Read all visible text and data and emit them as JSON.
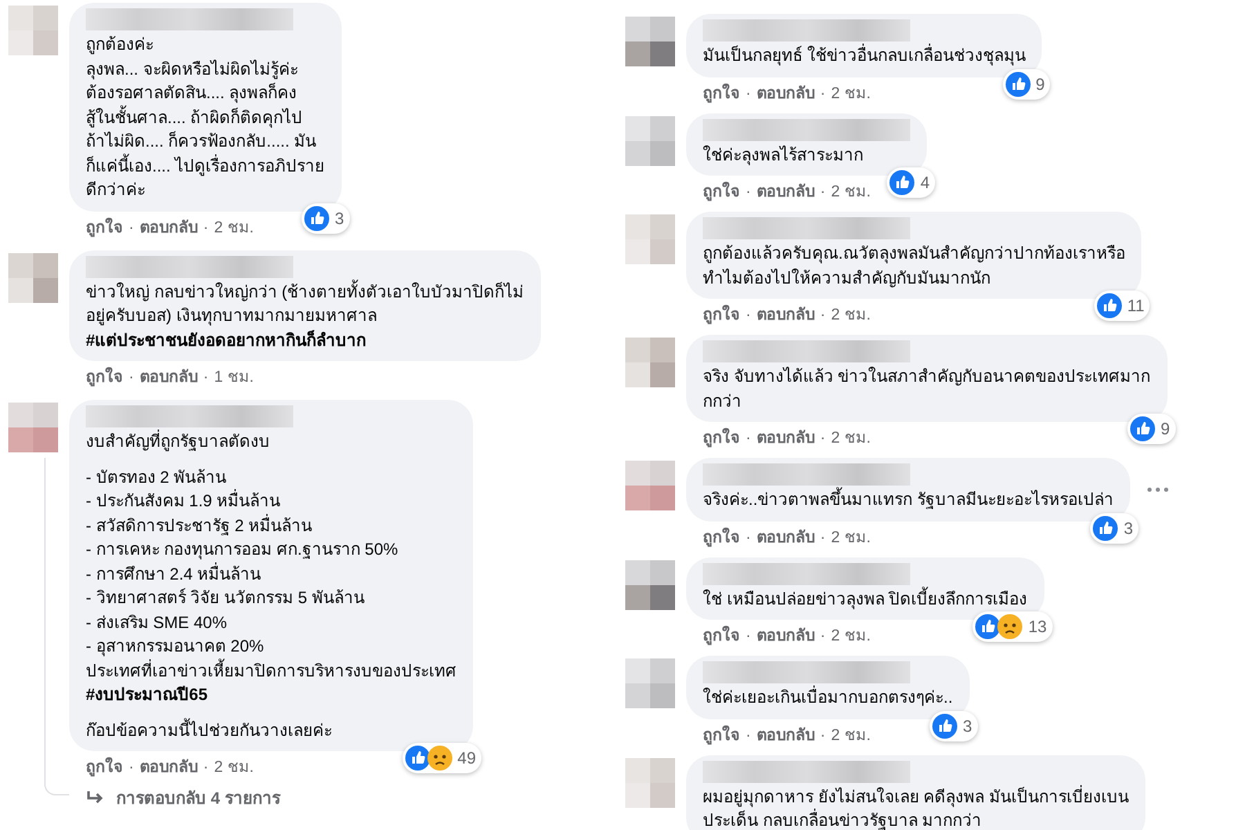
{
  "columns": [
    {
      "comments": [
        {
          "paragraphs": [
            "ถูกต้องค่ะ\nลุงพล... จะผิดหรือไม่ผิดไม่รู้ค่ะ\nต้องรอศาลตัดสิน.... ลุงพลก็คง\nสู้ในชั้นศาล.... ถ้าผิดก็ติดคุกไป\nถ้าไม่ผิด.... ก็ควรฟ้องกลับ..... มัน\nก็แค่นี้เอง.... ไปดูเรื่องการอภิปราย\nดีกว่าค่ะ"
          ],
          "reactions": [
            {
              "kind": "like"
            }
          ],
          "reaction_count": "3",
          "footer": [
            {
              "kind": "link",
              "text": "ถูกใจ"
            },
            {
              "kind": "dot",
              "text": "·"
            },
            {
              "kind": "link",
              "text": "ตอบกลับ"
            },
            {
              "kind": "dot",
              "text": "·"
            },
            {
              "kind": "time",
              "text": "2 ชม."
            }
          ],
          "options_menu": false
        },
        {
          "paragraphs": [
            "ข่าวใหญ่ กลบข่าวใหญ่กว่า (ช้างตายทั้งตัวเอาใบบัวมาปิดก็ไม่\nอยู่ครับบอส) เงินทุกบาทมากมายมหาศาล\n**#แต่ประชาชนยังอดอยากหากินก็ลำบาก**"
          ],
          "footer": [
            {
              "kind": "link",
              "text": "ถูกใจ"
            },
            {
              "kind": "dot",
              "text": "·"
            },
            {
              "kind": "link",
              "text": "ตอบกลับ"
            },
            {
              "kind": "dot",
              "text": "·"
            },
            {
              "kind": "time",
              "text": "1 ชม."
            }
          ],
          "options_menu": false
        },
        {
          "paragraphs": [
            "งบสำคัญที่ถูกรัฐบาลตัดงบ",
            "- บัตรทอง 2 พันล้าน\n- ประกันสังคม 1.9 หมื่นล้าน\n- สวัสดิการประชารัฐ 2 หมื่นล้าน\n- การเคหะ กองทุนการออม ศก.ฐานราก 50%\n- การศึกษา 2.4 หมื่นล้าน\n- วิทยาศาสตร์ วิจัย นวัตกรรม 5 พันล้าน\n- ส่งเสริม SME 40%\n- อุสาหกรรมอนาคต 20%\nประเทศที่เอาข่าวเหี้ยมาปิดการบริหารงบของประเทศ\n**#งบประมาณปี65**",
            "ก๊อปข้อความนี้ไปช่วยกันวางเลยค่ะ"
          ],
          "reactions": [
            {
              "kind": "like"
            },
            {
              "kind": "sad"
            }
          ],
          "reaction_count": "49",
          "footer": [
            {
              "kind": "link",
              "text": "ถูกใจ"
            },
            {
              "kind": "dot",
              "text": "·"
            },
            {
              "kind": "link",
              "text": "ตอบกลับ"
            },
            {
              "kind": "dot",
              "text": "·"
            },
            {
              "kind": "time",
              "text": "2 ชม."
            }
          ],
          "replies_link": "การตอบกลับ 4 รายการ",
          "options_menu": false
        }
      ]
    },
    {
      "comments": [
        {
          "paragraphs": [
            "มันเป็นกลยุทธ์ ใช้ข่าวอื่นกลบเกลื่อนช่วงชุลมุน"
          ],
          "reactions": [
            {
              "kind": "like"
            }
          ],
          "reaction_count": "9",
          "footer": [
            {
              "kind": "link",
              "text": "ถูกใจ"
            },
            {
              "kind": "dot",
              "text": "·"
            },
            {
              "kind": "link",
              "text": "ตอบกลับ"
            },
            {
              "kind": "dot",
              "text": "·"
            },
            {
              "kind": "time",
              "text": "2 ชม."
            }
          ],
          "options_menu": false
        },
        {
          "paragraphs": [
            "ใช่ค่ะลุงพลไร้สาระมาก"
          ],
          "reactions": [
            {
              "kind": "like"
            }
          ],
          "reaction_count": "4",
          "footer": [
            {
              "kind": "link",
              "text": "ถูกใจ"
            },
            {
              "kind": "dot",
              "text": "·"
            },
            {
              "kind": "link",
              "text": "ตอบกลับ"
            },
            {
              "kind": "dot",
              "text": "·"
            },
            {
              "kind": "time",
              "text": "2 ชม."
            }
          ],
          "options_menu": false
        },
        {
          "paragraphs": [
            "ถูกต้องแล้วครับคุณ.ณวัตลุงพลมันสำคัญกว่าปากท้องเราหรือ\nทำไมต้องไปให้ความสำคัญกับมันมากนัก"
          ],
          "reactions": [
            {
              "kind": "like"
            }
          ],
          "reaction_count": "11",
          "footer": [
            {
              "kind": "link",
              "text": "ถูกใจ"
            },
            {
              "kind": "dot",
              "text": "·"
            },
            {
              "kind": "link",
              "text": "ตอบกลับ"
            },
            {
              "kind": "dot",
              "text": "·"
            },
            {
              "kind": "time",
              "text": "2 ชม."
            }
          ],
          "options_menu": false
        },
        {
          "paragraphs": [
            "จริง จับทางได้แล้ว ข่าวในสภาสำคัญกับอนาคตของประเทศมาก\nกกว่า"
          ],
          "reactions": [
            {
              "kind": "like"
            }
          ],
          "reaction_count": "9",
          "footer": [
            {
              "kind": "link",
              "text": "ถูกใจ"
            },
            {
              "kind": "dot",
              "text": "·"
            },
            {
              "kind": "link",
              "text": "ตอบกลับ"
            },
            {
              "kind": "dot",
              "text": "·"
            },
            {
              "kind": "time",
              "text": "2 ชม."
            }
          ],
          "options_menu": false
        },
        {
          "paragraphs": [
            "จริงค่ะ..ข่าวตาพลขึ้นมาแทรก รัฐบาลมีนะยะอะไรหรอเปล่า"
          ],
          "reactions": [
            {
              "kind": "like"
            }
          ],
          "reaction_count": "3",
          "footer": [
            {
              "kind": "link",
              "text": "ถูกใจ"
            },
            {
              "kind": "dot",
              "text": "·"
            },
            {
              "kind": "link",
              "text": "ตอบกลับ"
            },
            {
              "kind": "dot",
              "text": "·"
            },
            {
              "kind": "time",
              "text": "2 ชม."
            }
          ],
          "options_menu": true
        },
        {
          "paragraphs": [
            "ใช่ เหมือนปล่อยข่าวลุงพล ปิดเบี้ยงลึกการเมือง"
          ],
          "reactions": [
            {
              "kind": "like"
            },
            {
              "kind": "sad"
            }
          ],
          "reaction_count": "13",
          "footer": [
            {
              "kind": "link",
              "text": "ถูกใจ"
            },
            {
              "kind": "dot",
              "text": "·"
            },
            {
              "kind": "link",
              "text": "ตอบกลับ"
            },
            {
              "kind": "dot",
              "text": "·"
            },
            {
              "kind": "time",
              "text": "2 ชม."
            }
          ],
          "options_menu": false
        },
        {
          "paragraphs": [
            "ใช่ค่ะเยอะเกินเบื่อมากบอกตรงๆค่ะ.."
          ],
          "reactions": [
            {
              "kind": "like"
            }
          ],
          "reaction_count": "3",
          "footer": [
            {
              "kind": "link",
              "text": "ถูกใจ"
            },
            {
              "kind": "dot",
              "text": "·"
            },
            {
              "kind": "link",
              "text": "ตอบกลับ"
            },
            {
              "kind": "dot",
              "text": "·"
            },
            {
              "kind": "time",
              "text": "2 ชม."
            }
          ],
          "options_menu": false
        },
        {
          "paragraphs": [
            "ผมอยู่มุกดาหาร ยังไม่สนใจเลย คดีลุงพล มันเป็นการเบี่ยงเบน\nประเด็น กลบเกลื่อนข่าวรัฐบาล มากกว่า"
          ],
          "options_menu": false
        }
      ]
    }
  ]
}
